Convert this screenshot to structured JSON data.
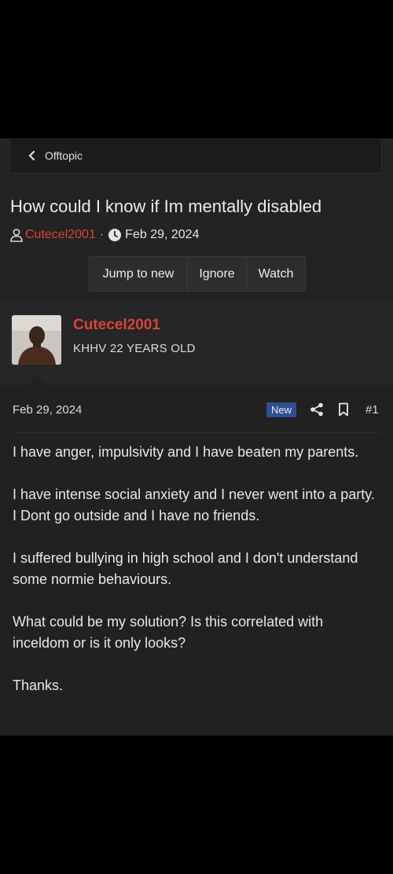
{
  "breadcrumb": {
    "label": "Offtopic"
  },
  "thread": {
    "title": "How could I know if Im mentally disabled",
    "author": "Cutecel2001",
    "separator": "·",
    "date": "Feb 29, 2024"
  },
  "actions": {
    "jump_to_new": "Jump to new",
    "ignore": "Ignore",
    "watch": "Watch"
  },
  "post": {
    "username": "Cutecel2001",
    "user_title": "KHHV 22 YEARS OLD",
    "date": "Feb 29, 2024",
    "badge": "New",
    "number": "#1",
    "paragraphs": [
      "I have anger, impulsivity and I have beaten my parents.",
      "I have intense social anxiety and I never went into a party. I Dont go outside and I have no friends.",
      "I suffered bullying in high school and I don't understand some normie behaviours.",
      "What could be my solution? Is this correlated with inceldom or is it only looks?",
      "Thanks."
    ]
  },
  "colors": {
    "username": "#d9443a",
    "badge_bg": "#2f4f8f",
    "background": "#232323"
  },
  "icons": [
    "chevron-left-icon",
    "user-icon",
    "clock-icon",
    "share-icon",
    "bookmark-icon"
  ]
}
